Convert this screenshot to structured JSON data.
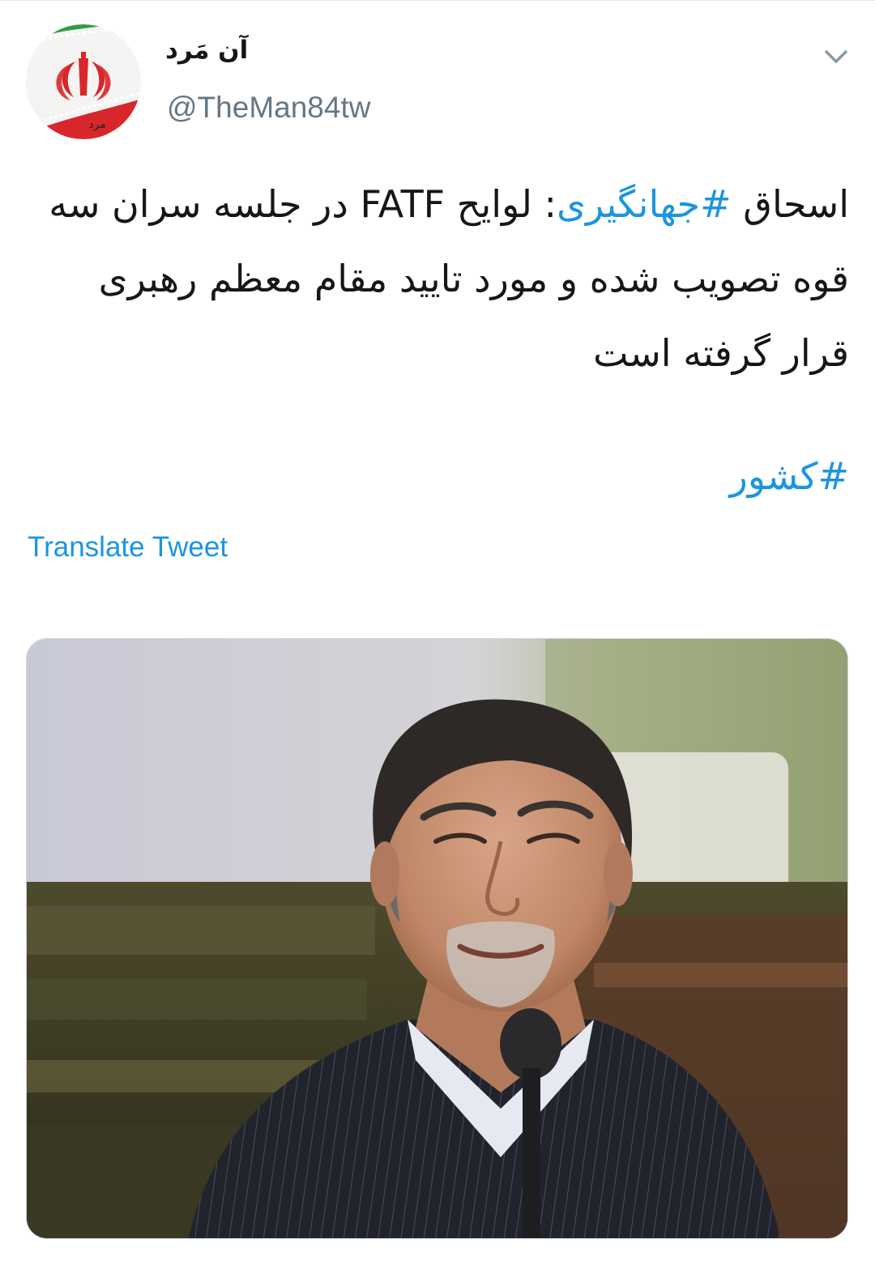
{
  "tweet": {
    "display_name": "آن مَرد",
    "handle": "@TheMan84tw",
    "text_prefix": "اسحاق ",
    "hashtag_1": "#جهانگیری",
    "text_rest": ": لوایح FATF در جلسه سران سه قوه تصویب شده و مورد تایید مقام معظم رهبری قرار گرفته است",
    "hashtag_2": "#کشور",
    "translate_label": "Translate Tweet"
  },
  "avatar": {
    "icon": "iran-flag-emblem-icon",
    "label": "مرد"
  },
  "menu": {
    "icon": "chevron-down-icon"
  },
  "colors": {
    "link": "#1b95e0",
    "text": "#14171a",
    "secondary": "#657786"
  }
}
